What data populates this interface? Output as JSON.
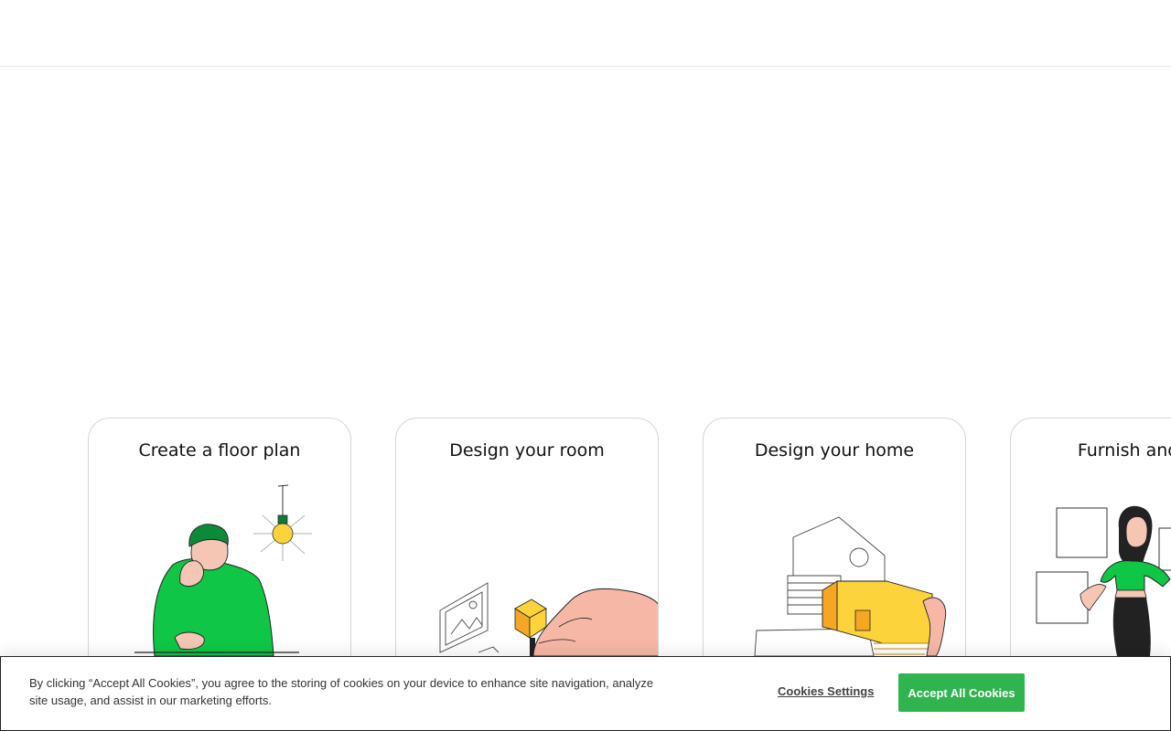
{
  "cards": [
    {
      "title": "Create a floor plan",
      "icon": "person-thinking-lightbulb-illustration"
    },
    {
      "title": "Design your room",
      "icon": "hand-placing-block-illustration"
    },
    {
      "title": "Design your home",
      "icon": "house-model-illustration"
    },
    {
      "title": "Furnish and de",
      "icon": "woman-with-frames-illustration"
    }
  ],
  "cookie_banner": {
    "text": "By clicking “Accept All Cookies”, you agree to the storing of cookies on your device to enhance site navigation, analyze site usage, and assist in our marketing efforts.",
    "settings_label": "Cookies Settings",
    "accept_label": "Accept All Cookies"
  },
  "colors": {
    "accent_green": "#2fb44e",
    "illustration_green": "#0fc646",
    "illustration_yellow": "#fcd33b"
  }
}
